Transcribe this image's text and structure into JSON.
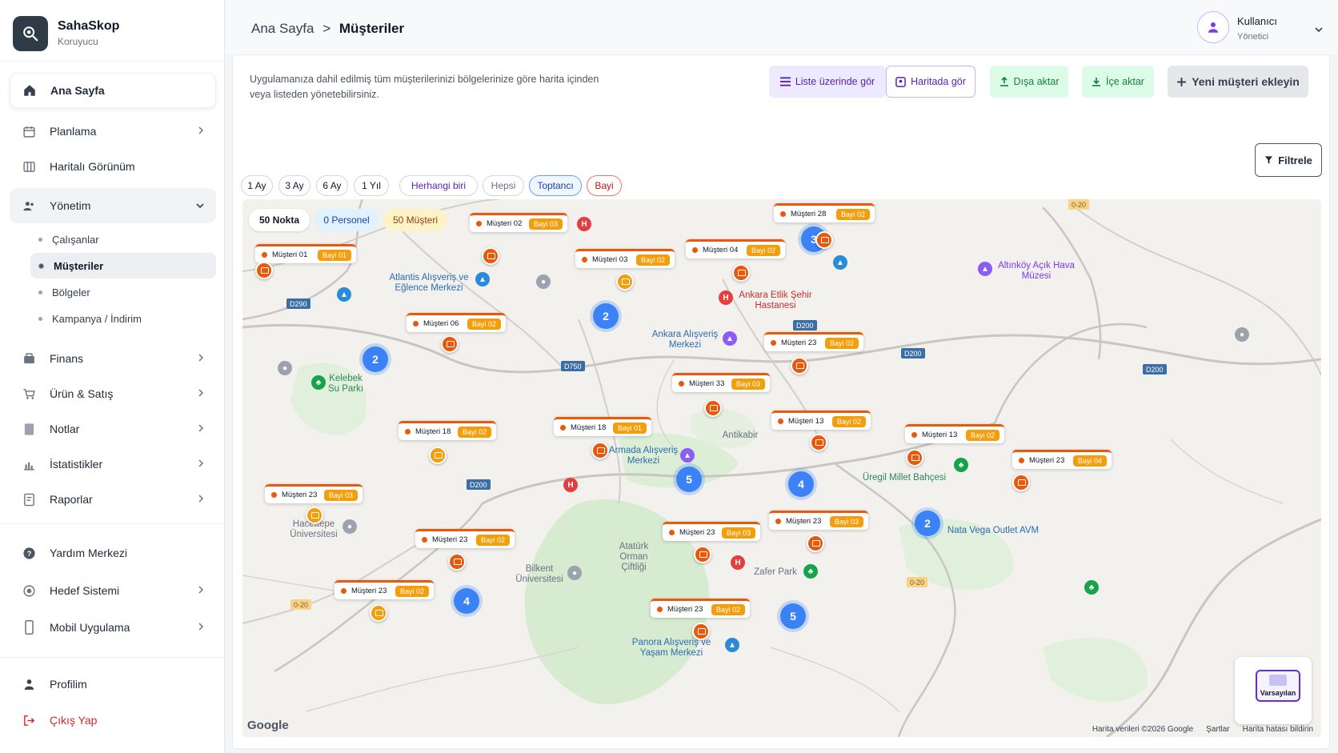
{
  "brand": {
    "name": "SahaSkop",
    "subtitle": "Koruyucu"
  },
  "sidebar": {
    "items": [
      {
        "label": "Ana Sayfa",
        "icon": "home-icon"
      },
      {
        "label": "Planlama",
        "icon": "calendar-icon"
      },
      {
        "label": "Haritalı Görünüm",
        "icon": "map-icon"
      },
      {
        "label": "Yönetim",
        "icon": "users-icon"
      },
      {
        "label": "Finans",
        "icon": "wallet-icon"
      },
      {
        "label": "Ürün & Satış",
        "icon": "cart-icon"
      },
      {
        "label": "Notlar",
        "icon": "note-icon"
      },
      {
        "label": "İstatistikler",
        "icon": "chart-icon"
      },
      {
        "label": "Raporlar",
        "icon": "report-icon"
      },
      {
        "label": "Yardım Merkezi",
        "icon": "help-icon"
      },
      {
        "label": "Hedef Sistemi",
        "icon": "target-icon"
      },
      {
        "label": "Mobil Uygulama",
        "icon": "mobile-icon"
      },
      {
        "label": "Profilim",
        "icon": "user-icon"
      },
      {
        "label": "Çıkış Yap",
        "icon": "logout-icon"
      }
    ],
    "subitems": [
      "Çalışanlar",
      "Müşteriler",
      "Bölgeler",
      "Kampanya / İndirim"
    ]
  },
  "header": {
    "breadcrumb_root": "Ana Sayfa",
    "breadcrumb_sep": ">",
    "breadcrumb_current": "Müşteriler",
    "user_name": "Kullanıcı",
    "user_role": "Yönetici"
  },
  "main": {
    "description": "Uygulamanıza dahil edilmiş tüm müşterilerinizi bölgelerinize göre harita içinden veya listeden yönetebilirsiniz.",
    "buttons": {
      "list_view": "Liste üzerinde gör",
      "map_view": "Haritada gör",
      "export": "Dışa aktar",
      "import": "İçe aktar",
      "new_customer": "Yeni müşteri ekleyin",
      "filter": "Filtrele"
    },
    "chips": [
      "1 Ay",
      "3 Ay",
      "6 Ay",
      "1 Yıl",
      "Herhangi biri",
      "Hepsi",
      "Toptancı",
      "Bayi"
    ]
  },
  "map": {
    "stats": {
      "nokta": "50 Nokta",
      "personel": "0 Personel",
      "musteri": "50 Müşteri"
    },
    "markers": [
      {
        "name": "Müşteri 01",
        "bayi": "Bayi 01"
      },
      {
        "name": "Müşteri 02",
        "bayi": "Bayi 03"
      },
      {
        "name": "Müşteri 03",
        "bayi": "Bayi 02"
      },
      {
        "name": "Müşteri 04",
        "bayi": "Bayi 02"
      },
      {
        "name": "Müşteri 28",
        "bayi": "Bayi 02"
      },
      {
        "name": "Müşteri 06",
        "bayi": "Bayi 02"
      },
      {
        "name": "Müşteri 23",
        "bayi": "Bayi 02"
      },
      {
        "name": "Müşteri 33",
        "bayi": "Bayi 03"
      },
      {
        "name": "Müşteri 18",
        "bayi": "Bayi 02"
      },
      {
        "name": "Müşteri 18",
        "bayi": "Bayi 01"
      },
      {
        "name": "Müşteri 13",
        "bayi": "Bayi 02"
      },
      {
        "name": "Müşteri 13",
        "bayi": "Bayi 02"
      },
      {
        "name": "Müşteri 23",
        "bayi": "Bayi 04"
      },
      {
        "name": "Müşteri 23",
        "bayi": "Bayi 03"
      },
      {
        "name": "Müşteri 23",
        "bayi": "Bayi 02"
      },
      {
        "name": "Müşteri 23",
        "bayi": "Bayi 03"
      },
      {
        "name": "Müşteri 23",
        "bayi": "Bayi 03"
      },
      {
        "name": "Müşteri 23",
        "bayi": "Bayi 02"
      },
      {
        "name": "Müşteri 23",
        "bayi": "Bayi 02"
      }
    ],
    "clusters": [
      "3",
      "2",
      "2",
      "5",
      "4",
      "2",
      "4",
      "5"
    ],
    "places": {
      "atlantis": "Atlantis Alışveriş ve Eğlence Merkezi",
      "ankara_etlik": "Ankara Etlik Şehir Hastanesi",
      "altinkoy": "Altınköy Açık Hava Müzesi",
      "ankara_avm": "Ankara Alışveriş Merkezi",
      "kelebek": "Kelebek Su Parkı",
      "antikabir": "Antikabir",
      "armada": "Armada Alışveriş Merkezi",
      "uregil": "Üregil Millet Bahçesi",
      "hacettepe": "Hacettepe Üniversitesi",
      "ataturk": "Atatürk Orman Çiftliği",
      "bilkent": "Bilkent Üniversitesi",
      "zafer": "Zafer Park",
      "nata": "Nata Vega Outlet AVM",
      "panora": "Panora Alışveriş ve Yaşam Merkezi"
    },
    "roads": [
      "D290",
      "D750",
      "D200",
      "D200",
      "D200",
      "D200",
      "0-20",
      "0-20",
      "0-20"
    ],
    "google": "Google",
    "attribution": [
      "Harita verileri ©2026 Google",
      "Şartlar",
      "Harita hatası bildirin"
    ],
    "map_type": "Varsayılan"
  },
  "colors": {
    "accent": "#6d28d9",
    "marker": "#ea580c",
    "cluster": "#3b82f6",
    "bayi": "#f59e0b"
  }
}
